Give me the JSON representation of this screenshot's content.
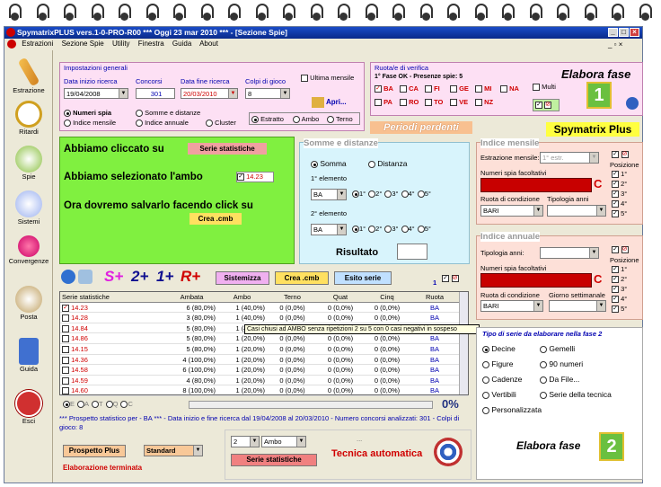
{
  "titlebar": {
    "text": "SpymatrixPLUS  vers.1-0-PRO-R00   ***  Oggi 23 mar 2010   ***  - [Sezione Spie]"
  },
  "menu": [
    "Estrazioni",
    "Sezione Spie",
    "Utility",
    "Finestra",
    "Guida",
    "About"
  ],
  "sidebar": [
    {
      "label": "Estrazione"
    },
    {
      "label": "Ritardi"
    },
    {
      "label": "Spie"
    },
    {
      "label": "Sistemi"
    },
    {
      "label": "Convergenze"
    },
    {
      "label": "Posta"
    },
    {
      "label": "Guida"
    },
    {
      "label": "Esci"
    }
  ],
  "impostazioni": {
    "title": "Impostazioni generali",
    "data_inizio_label": "Data inizio ricerca",
    "data_inizio": "19/04/2008",
    "concorsi_label": "Concorsi",
    "concorsi": "301",
    "data_fine_label": "Data fine ricerca",
    "data_fine": "20/03/2010",
    "colpi_label": "Colpi di gioco",
    "colpi": "8",
    "ultima_mensile": "Ultima mensile",
    "apri": "Apri...",
    "numeri_spia": "Numeri spia",
    "indice_mensile": "Indice mensile",
    "somme_distanze": "Somme e distanze",
    "indice_annuale": "Indice annuale",
    "cluster": "Cluster",
    "estratto": "Estratto",
    "ambo": "Ambo",
    "terno": "Terno"
  },
  "ruota": {
    "title": "Ruota/e di verifica",
    "status": "1° Fase OK - Presenze spie: 5",
    "wheels": [
      "BA",
      "CA",
      "FI",
      "GE",
      "MI",
      "NA",
      "PA",
      "RO",
      "TO",
      "VE",
      "NZ"
    ],
    "multi": "Multi",
    "elabora": "Elabora fase"
  },
  "periodi": "Periodi perdenti",
  "brand": "Spymatrix Plus",
  "note": {
    "line1": "Abbiamo cliccato su",
    "btn1": "Serie statistiche",
    "line2": "Abbiamo selezionato l'ambo",
    "ambo": "14.23",
    "line3": "Ora dovremo salvarlo facendo click su",
    "btn2": "Crea .cmb"
  },
  "somme": {
    "title": "Somme e distanze",
    "somma": "Somma",
    "distanza": "Distanza",
    "el1": "1° elemento",
    "el2": "2° elemento",
    "ruota1": "BA",
    "ruota2": "BA",
    "pos": [
      "1°",
      "2°",
      "3°",
      "4°",
      "5°"
    ],
    "risultato": "Risultato"
  },
  "indice_mensile": {
    "title": "Indice mensile",
    "estr_label": "Estrazione mensile:",
    "estr": "1° estr.",
    "numeri_label": "Numeri spia facoltativi",
    "ruota_label": "Ruota di condizione",
    "tip_label": "Tipologia anni",
    "ruota": "BARI",
    "posizione": "Posizione",
    "pos": [
      "1°",
      "2°",
      "3°",
      "4°",
      "5°"
    ]
  },
  "indice_annuale": {
    "title": "Indice annuale",
    "tip_label": "Tipologia anni:",
    "numeri_label": "Numeri spia facoltativi",
    "ruota_label": "Ruota di condizione",
    "giorno_label": "Giorno settimanale",
    "ruota": "BARI",
    "posizione": "Posizione",
    "pos": [
      "1°",
      "2°",
      "3°",
      "4°",
      "5°"
    ]
  },
  "toolbar": {
    "splus": "S+",
    "two": "2+",
    "one": "1+",
    "rplus": "R+",
    "sistemizza": "Sistemizza",
    "crea": "Crea .cmb",
    "esito": "Esito serie",
    "num": "1"
  },
  "table": {
    "headers": [
      "Serie statistiche",
      "Ambata",
      "Ambo",
      "Terno",
      "Quat",
      "Cinq",
      "Ruota"
    ],
    "rows": [
      [
        "14.23",
        "6 (80,0%)",
        "1 (40,0%)",
        "0 (0,0%)",
        "0 (0,0%)",
        "0 (0,0%)",
        "BA"
      ],
      [
        "14.28",
        "3 (80,0%)",
        "1 (40,0%)",
        "0 (0,0%)",
        "0 (0,0%)",
        "0 (0,0%)",
        "BA"
      ],
      [
        "14.84",
        "5 (80,0%)",
        "1 (40,0%)",
        "0 (0,0%)",
        "0 (0,0%)",
        "0 (0,0%)",
        "BA"
      ],
      [
        "14.86",
        "5 (80,0%)",
        "1 (20,0%)",
        "0 (0,0%)",
        "0 (0,0%)",
        "0 (0,0%)",
        "BA"
      ],
      [
        "14.15",
        "5 (80,0%)",
        "1 (20,0%)",
        "0 (0,0%)",
        "0 (0,0%)",
        "0 (0,0%)",
        "BA"
      ],
      [
        "14.36",
        "4 (100,0%)",
        "1 (20,0%)",
        "0 (0,0%)",
        "0 (0,0%)",
        "0 (0,0%)",
        "BA"
      ],
      [
        "14.58",
        "6 (100,0%)",
        "1 (20,0%)",
        "0 (0,0%)",
        "0 (0,0%)",
        "0 (0,0%)",
        "BA"
      ],
      [
        "14.59",
        "4 (80,0%)",
        "1 (20,0%)",
        "0 (0,0%)",
        "0 (0,0%)",
        "0 (0,0%)",
        "BA"
      ],
      [
        "14.60",
        "8 (100,0%)",
        "1 (20,0%)",
        "0 (0,0%)",
        "0 (0,0%)",
        "0 (0,0%)",
        "BA"
      ]
    ],
    "tooltip": "Casi chiusi ad AMBO senza ripetizioni 2 su 5 con 0 casi negativi in sospeso"
  },
  "filters": [
    "E",
    "A",
    "T",
    "Q",
    "C"
  ],
  "progress": {
    "value": 0,
    "label": "0%"
  },
  "prospetto": "*** Prospetto statistico per  - BA *** - Data inizio e fine ricerca dal 19/04/2008 al 20/03/2010 - Numero concorsi analizzati: 301 - Colpi di gioco: 8",
  "bottom": {
    "prospetto_plus": "Prospetto Plus",
    "standard": "Standard",
    "elaborazione": "Elaborazione terminata",
    "num": "2",
    "ambo": "Ambo",
    "serie": "Serie statistiche",
    "tecnica": "Tecnica automatica",
    "dots": "..."
  },
  "tipo": {
    "title": "Tipo di serie da elaborare nella fase 2",
    "opts": [
      "Decine",
      "Gemelli",
      "Figure",
      "90 numeri",
      "Cadenze",
      "Da File...",
      "Vertibili",
      "Serie della tecnica",
      "Personalizzata"
    ],
    "elabora": "Elabora fase"
  }
}
